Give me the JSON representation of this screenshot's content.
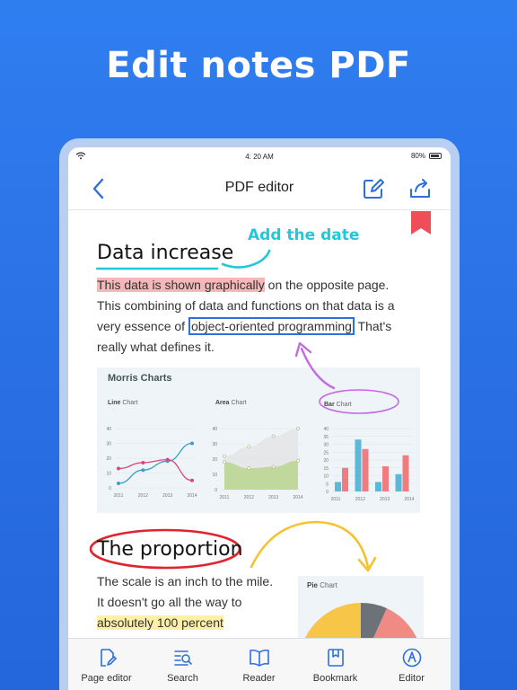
{
  "headline": "Edit notes PDF",
  "status": {
    "time": "4: 20 AM",
    "battery": "80%"
  },
  "nav": {
    "title": "PDF editor"
  },
  "doc": {
    "heading1": "Data increase",
    "annotation": "Add the date",
    "para1": {
      "highlight": "This data is shown graphically",
      "rest1": " on the opposite page.",
      "line2": "This combining of data and functions on that data is a",
      "line3a": "very essence of ",
      "boxed": "object-oriented programming",
      "line3b": " That's",
      "line4": "really what defines it."
    },
    "chart_panel_title": "Morris Charts",
    "heading2": "The proportion",
    "para2": {
      "line1": "The scale is an inch to the mile.",
      "line2": "It doesn't go all the way to",
      "highlight": "absolutely 100 percent"
    }
  },
  "chart_data": [
    {
      "type": "line",
      "title_bold": "Line",
      "title_rest": " Chart",
      "x": [
        "2011",
        "2012",
        "2013",
        "2014"
      ],
      "ylim": [
        0,
        40
      ],
      "yticks": [
        "40",
        "30",
        "20",
        "10",
        "0"
      ],
      "series": [
        {
          "values": [
            3,
            12,
            18,
            30
          ],
          "color": "#3aa0c8"
        },
        {
          "values": [
            13,
            17,
            19,
            5
          ],
          "color": "#d64a7a"
        }
      ]
    },
    {
      "type": "area",
      "title_bold": "Area",
      "title_rest": " Chart",
      "x": [
        "2011",
        "2012",
        "2013",
        "2014"
      ],
      "ylim": [
        0,
        40
      ],
      "yticks": [
        "40",
        "30",
        "20",
        "10",
        "0"
      ],
      "series": [
        {
          "values": [
            18,
            14,
            15,
            19
          ],
          "color": "#b8d48a"
        },
        {
          "values": [
            22,
            28,
            35,
            40
          ],
          "color": "#e4e4e4"
        }
      ]
    },
    {
      "type": "bar",
      "title_bold": "Bar",
      "title_rest": " Chart",
      "x": [
        "2011",
        "2012",
        "2013",
        "2014"
      ],
      "ylim": [
        0,
        40
      ],
      "yticks": [
        "40",
        "35",
        "30",
        "25",
        "20",
        "15",
        "10",
        "5",
        "0"
      ],
      "series": [
        {
          "values": [
            6,
            15,
            33,
            27,
            6,
            16,
            11,
            23
          ],
          "colors": [
            "#5cb8d6",
            "#f07c80"
          ]
        }
      ]
    },
    {
      "type": "pie",
      "title_bold": "Pie",
      "title_rest": " Chart",
      "colors": [
        "#f7c548",
        "#6d7178",
        "#f08a84",
        "#cfd6df"
      ]
    }
  ],
  "tabs": [
    {
      "label": "Page editor",
      "icon": "page-edit-icon"
    },
    {
      "label": "Search",
      "icon": "search-icon"
    },
    {
      "label": "Reader",
      "icon": "book-icon"
    },
    {
      "label": "Bookmark",
      "icon": "bookmark-icon"
    },
    {
      "label": "Editor",
      "icon": "editor-pen-icon"
    }
  ],
  "colors": {
    "accent": "#2d6fdc",
    "background": "#2a6fe4"
  }
}
